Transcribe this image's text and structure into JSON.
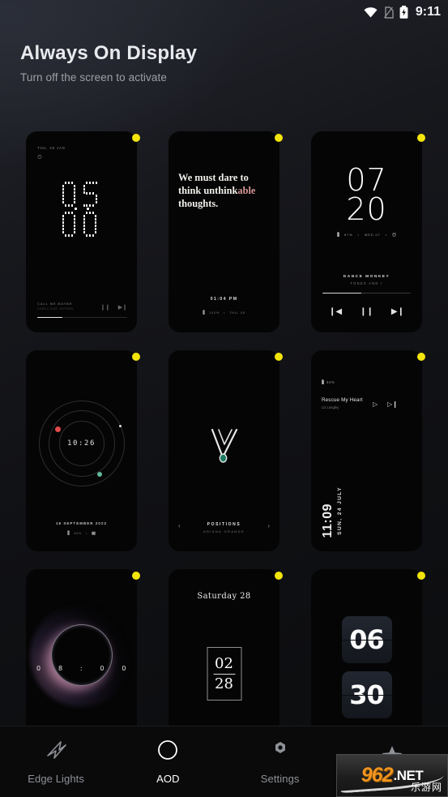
{
  "statusbar": {
    "time": "9:11",
    "wifi_icon": "wifi-icon",
    "sim_icon": "no-sim-icon",
    "battery_icon": "battery-charging-icon"
  },
  "header": {
    "title": "Always On Display",
    "subtitle": "Turn off the screen to activate"
  },
  "accent": {
    "badge": "#f3e50b",
    "quote_highlight": "#d79595",
    "orb_red": "#e24b4b",
    "orb_green": "#62b89b"
  },
  "styles": [
    {
      "id": "dot-matrix-clock",
      "date": "THU, 28 JAN",
      "alarm_icon": "alarm-icon",
      "hours": "05",
      "minutes": "00",
      "player": {
        "title": "CALL ME MAYBE",
        "artist": "CARLY RAE JEPSEN",
        "pause_icon": "pause-icon",
        "next_icon": "next-icon",
        "progress": 28
      }
    },
    {
      "id": "quote-card",
      "quote_line1": "We must dare to",
      "quote_line2a": "think unthink",
      "quote_line2b": "able",
      "quote_line3": "thoughts.",
      "time": "01:04 PM",
      "battery_icon": "battery-icon",
      "battery": "100%",
      "separator": "•",
      "date": "THU, 05"
    },
    {
      "id": "big-digits-music",
      "hours": "07",
      "minutes": "20",
      "battery_icon": "battery-icon",
      "battery": "87%",
      "sep1": "•",
      "date": "WED 07",
      "sep2": "•",
      "alarm_icon": "alarm-icon",
      "song_title": "DANCE MONKEY",
      "song_artist": "TONES AND I",
      "progress": 44,
      "prev_icon": "previous-icon",
      "pause_icon": "pause-icon",
      "next_icon": "next-icon"
    },
    {
      "id": "orbit-clock",
      "time": "10:26",
      "date": "18 SEPTEMBER 2022",
      "battery_icon": "battery-icon",
      "battery": "35%",
      "separator": "•",
      "calendar_icon": "calendar-icon"
    },
    {
      "id": "checkmark-music",
      "artwork_icon": "checkmark-outline-icon",
      "song_title": "POSITIONS",
      "song_artist": "ARIANA GRANDE",
      "prev_icon": "chevron-left-icon",
      "next_icon": "chevron-right-icon"
    },
    {
      "id": "vertical-date-music",
      "battery_icon": "battery-icon",
      "battery": "34%",
      "song_title": "Rescue My Heart",
      "song_artist": "Liz Longley",
      "play_icon": "play-icon",
      "next_icon": "next-icon",
      "date": "SUN, 24 JULY",
      "time": "11:09"
    },
    {
      "id": "eclipse-clock",
      "d1": "0",
      "d2": "8",
      "colon": ":",
      "d3": "0",
      "d4": "0"
    },
    {
      "id": "boxed-date-clock",
      "day": "Saturday 28",
      "hours": "02",
      "minutes": "28"
    },
    {
      "id": "flip-clock",
      "hours": "06",
      "minutes": "30"
    }
  ],
  "nav": {
    "items": [
      {
        "label": "Edge Lights",
        "icon": "edge-lights-icon",
        "active": false
      },
      {
        "label": "AOD",
        "icon": "aod-moon-icon",
        "active": true
      },
      {
        "label": "Settings",
        "icon": "gear-icon",
        "active": false
      },
      {
        "label": "",
        "icon": "star-icon",
        "active": false
      }
    ]
  },
  "watermark": {
    "num": "962",
    "net": ".NET",
    "cn": "乐游网"
  }
}
